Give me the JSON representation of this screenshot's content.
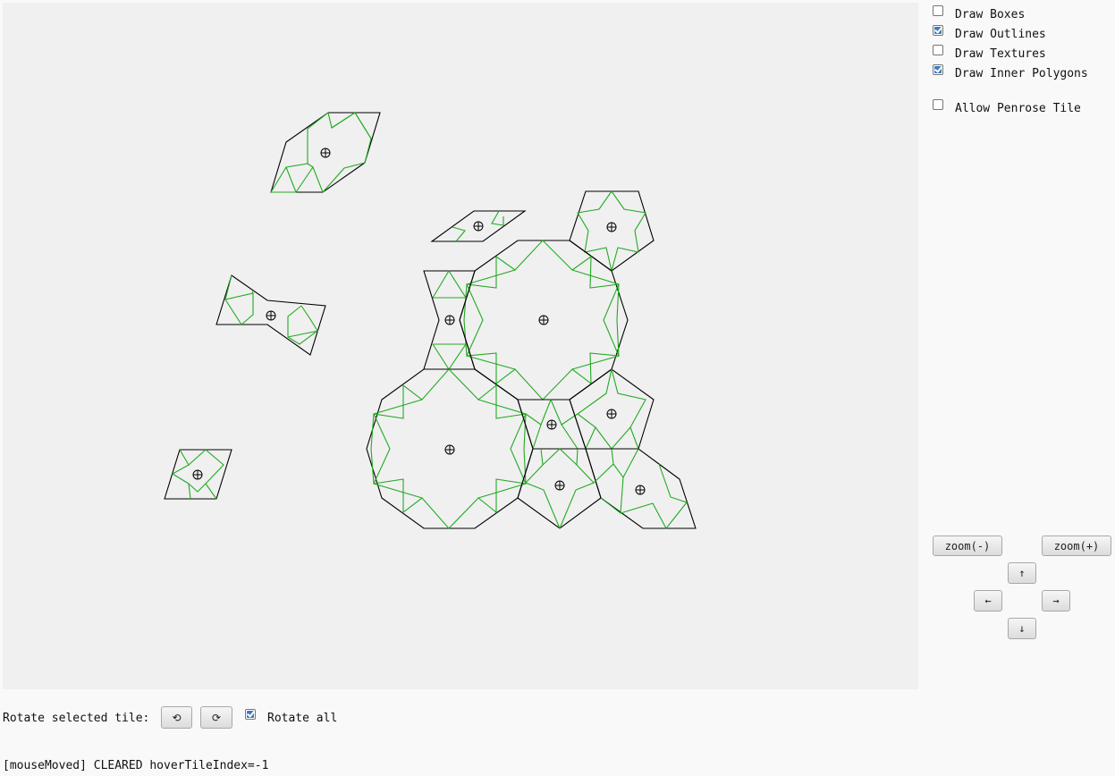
{
  "options": {
    "draw_boxes": {
      "label": "Draw Boxes",
      "checked": false
    },
    "draw_outlines": {
      "label": "Draw Outlines",
      "checked": true
    },
    "draw_textures": {
      "label": "Draw Textures",
      "checked": false
    },
    "draw_inner_polygons": {
      "label": "Draw Inner Polygons",
      "checked": true
    },
    "allow_penrose": {
      "label": "Allow Penrose Tile",
      "checked": false
    }
  },
  "navigation": {
    "zoom_out_label": "zoom(-)",
    "zoom_in_label": "zoom(+)",
    "up_label": "↑",
    "left_label": "←",
    "right_label": "→",
    "down_label": "↓"
  },
  "rotate": {
    "label": "Rotate selected tile:",
    "ccw_label": "⟲",
    "cw_label": "⟳",
    "rotate_all_label": "Rotate all",
    "rotate_all_checked": true
  },
  "status": {
    "text": "[mouseMoved] CLEARED hoverTileIndex=-1"
  },
  "colors": {
    "canvas_bg": "#f0f0f0",
    "outline": "#000000",
    "inner_polygon": "#22aa22"
  }
}
